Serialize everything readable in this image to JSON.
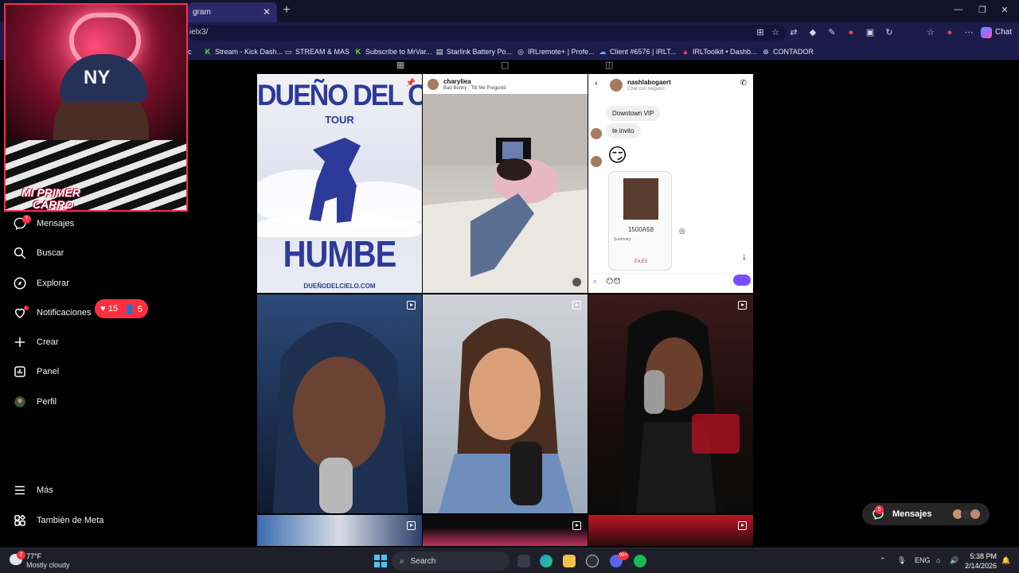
{
  "browser": {
    "tab_title": "gram",
    "address": "ielx3/",
    "chat_label": "Chat",
    "bookmarks": [
      {
        "label": "c",
        "icon": "generic-icon"
      },
      {
        "label": "Stream - Kick Dash...",
        "icon": "kick-icon"
      },
      {
        "label": "STREAM & MAS",
        "icon": "folder-icon"
      },
      {
        "label": "Subscribe to MrVar...",
        "icon": "kick-icon"
      },
      {
        "label": "Starlink Battery Po...",
        "icon": "page-icon"
      },
      {
        "label": "IRLremote+ | Profe...",
        "icon": "globe-icon"
      },
      {
        "label": "Client #6576 | IRLT...",
        "icon": "cloud-icon"
      },
      {
        "label": "IRLToolkit • Dashb...",
        "icon": "irltoolkit-icon"
      },
      {
        "label": "CONTADOR",
        "icon": "contador-icon"
      }
    ]
  },
  "sidebar": {
    "items": [
      {
        "label": "Mensajes",
        "icon": "messenger-icon",
        "badge": "7"
      },
      {
        "label": "Buscar",
        "icon": "search-icon"
      },
      {
        "label": "Explorar",
        "icon": "compass-icon"
      },
      {
        "label": "Notificaciones",
        "icon": "heart-icon"
      },
      {
        "label": "Crear",
        "icon": "plus-icon"
      },
      {
        "label": "Panel",
        "icon": "chart-icon"
      },
      {
        "label": "Perfil",
        "icon": "avatar-icon"
      },
      {
        "label": "Más",
        "icon": "menu-icon"
      },
      {
        "label": "También de Meta",
        "icon": "meta-icon"
      }
    ],
    "notif_likes": "15",
    "notif_follows": "5"
  },
  "posts": {
    "p1": {
      "title": "DUEÑO DEL CIELO",
      "subtitle": "TOUR",
      "artist": "HUMBE",
      "url": "DUEÑODELCIELO.COM"
    },
    "p2": {
      "username": "charyliea",
      "song": "Bad Bunny · Tití Me Preguntó"
    },
    "p3": {
      "username": "nashlabogaert",
      "subtitle": "Chat con negocio",
      "msg1": "Downtown VIP",
      "msg2": "te invito",
      "code": "1500A58",
      "summary": "Summary",
      "code2": "E4,E5"
    }
  },
  "messages_pill": {
    "label": "Mensajes",
    "badge": "5"
  },
  "webcam": {
    "caption_line1": "MI PRIMER",
    "caption_line2": "CARRO"
  },
  "taskbar": {
    "temperature": "77°F",
    "weather": "Mostly cloudy",
    "weather_badge": "2",
    "search_label": "Search",
    "language": "ENG",
    "time": "5:38 PM",
    "date": "2/14/2026",
    "discord_badge": "99+"
  }
}
